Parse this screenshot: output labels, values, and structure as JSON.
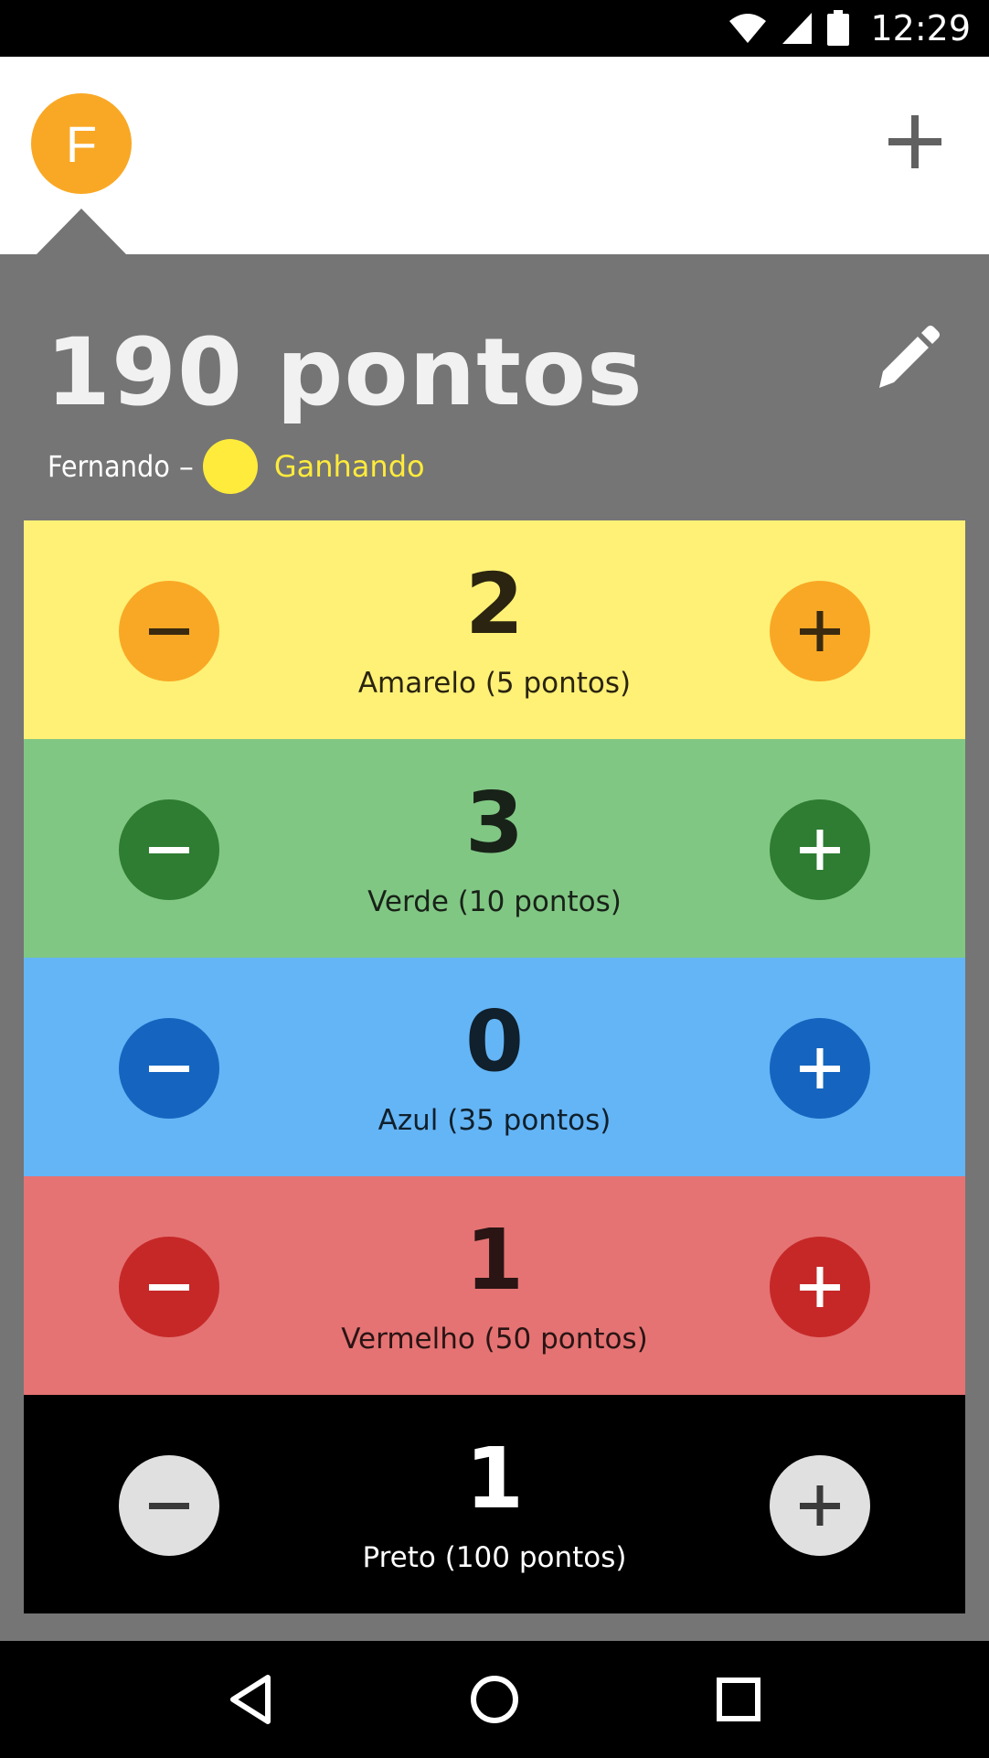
{
  "status_bar": {
    "time": "12:29"
  },
  "player": {
    "initial": "F",
    "avatar_color": "#F9A825",
    "points_title": "190 pontos",
    "name": "Fernando",
    "dash": "–",
    "status": "Ganhando",
    "status_color": "#FFEB3B"
  },
  "icons": {
    "add": "plus-icon",
    "edit": "pencil-icon"
  },
  "rows": [
    {
      "count": "2",
      "label": "Amarelo (5 pontos)",
      "bg": "#FFF176",
      "btn": "#F9A825",
      "sign": "#3a2a10",
      "text": "#2a2410"
    },
    {
      "count": "3",
      "label": "Verde (10 pontos)",
      "bg": "#81C784",
      "btn": "#2E7D32",
      "sign": "#ffffff",
      "text": "#182218"
    },
    {
      "count": "0",
      "label": "Azul (35 pontos)",
      "bg": "#64B5F6",
      "btn": "#1565C0",
      "sign": "#ffffff",
      "text": "#10202c"
    },
    {
      "count": "1",
      "label": "Vermelho (50 pontos)",
      "bg": "#E57373",
      "btn": "#C62828",
      "sign": "#ffffff",
      "text": "#2a1414"
    },
    {
      "count": "1",
      "label": "Preto (100 pontos)",
      "bg": "#000000",
      "btn": "#E0E0E0",
      "sign": "#3a3a3a",
      "text": "#ffffff"
    }
  ]
}
